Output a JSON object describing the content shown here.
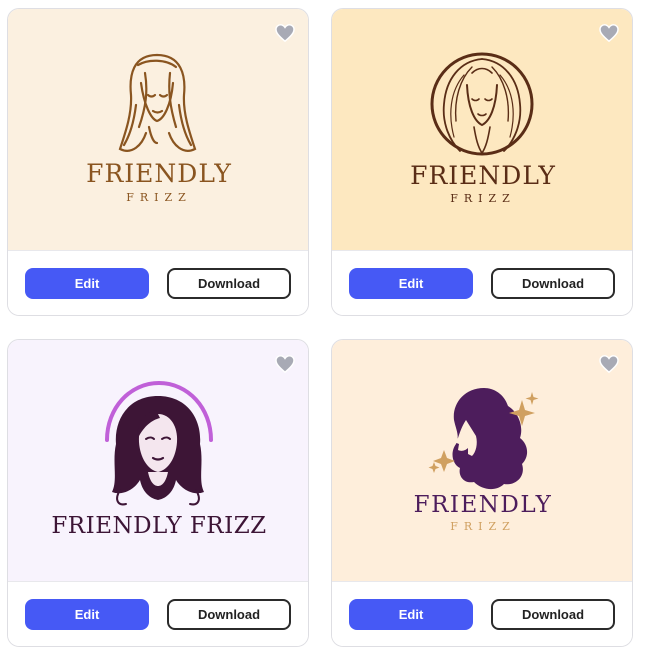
{
  "cards": [
    {
      "brand_main": "FRIENDLY",
      "brand_sub": "FRIZZ",
      "bg": "#fbf0e0",
      "ink": "#8a5520",
      "illustration_icon": "woman-long-hair-icon",
      "edit_label": "Edit",
      "download_label": "Download",
      "favorite_icon": "heart-icon"
    },
    {
      "brand_main": "FRIENDLY",
      "brand_sub": "FRIZZ",
      "bg": "#fde8c0",
      "ink": "#5a2d16",
      "illustration_icon": "woman-face-circle-icon",
      "edit_label": "Edit",
      "download_label": "Download",
      "favorite_icon": "heart-icon"
    },
    {
      "brand_main": "FRIENDLY FRIZZ",
      "brand_sub": "",
      "bg": "#f8f3fd",
      "ink": "#3d1536",
      "accent": "#c060d8",
      "illustration_icon": "woman-arch-portrait-icon",
      "edit_label": "Edit",
      "download_label": "Download",
      "favorite_icon": "heart-icon"
    },
    {
      "brand_main": "FRIENDLY",
      "brand_sub": "FRIZZ",
      "bg": "#feeedb",
      "ink": "#4d1d5c",
      "accent": "#d0a060",
      "illustration_icon": "woman-profile-sparkles-icon",
      "edit_label": "Edit",
      "download_label": "Download",
      "favorite_icon": "heart-icon"
    }
  ]
}
